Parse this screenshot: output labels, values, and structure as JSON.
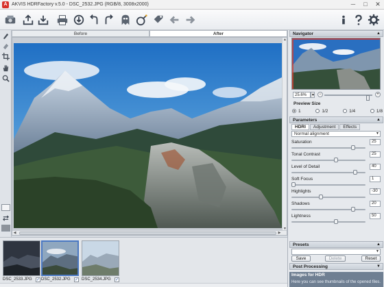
{
  "window": {
    "title": "AKVIS HDRFactory v.5.0 - DSC_2532.JPG (RGB/8, 3008x2000)",
    "logo_letter": "A",
    "minimize": "─",
    "maximize": "□",
    "close": "✕"
  },
  "view_tabs": {
    "before": "Before",
    "after": "After"
  },
  "filmstrip": {
    "items": [
      {
        "name": "DSC_2533.JPG",
        "checked": "✓"
      },
      {
        "name": "DSC_2532.JPG",
        "checked": "✓"
      },
      {
        "name": "DSC_2534.JPG",
        "checked": "✓"
      }
    ]
  },
  "navigator": {
    "header": "Navigator",
    "zoom": "25.6%",
    "minus": "−",
    "plus": "+"
  },
  "preview_size": {
    "header": "Preview Size",
    "options": [
      "1",
      "1/2",
      "1/4",
      "1/8"
    ]
  },
  "parameters": {
    "header": "Parameters",
    "tabs": [
      "HDRI",
      "Adjustment",
      "Effects"
    ],
    "alignment": "Normal alignment",
    "items": [
      {
        "label": "Saturation",
        "value": "25"
      },
      {
        "label": "Tonal Contrast",
        "value": "25"
      },
      {
        "label": "Level of Detail",
        "value": "40"
      },
      {
        "label": "Soft Focus",
        "value": "1"
      },
      {
        "label": "Highlights",
        "value": "-30"
      },
      {
        "label": "Shadows",
        "value": "20"
      },
      {
        "label": "Lightness",
        "value": "50"
      }
    ]
  },
  "presets": {
    "header": "Presets",
    "save": "Save",
    "delete": "Delete",
    "reset": "Reset"
  },
  "post_processing": {
    "header": "Post Processing"
  },
  "help": {
    "title": "Images for HDR",
    "text": "Here you can see thumbnails of the opened files."
  },
  "colors": {
    "accent": "#4a78c2",
    "help_bg": "#6f7f92",
    "close_red": "#d8322a"
  }
}
